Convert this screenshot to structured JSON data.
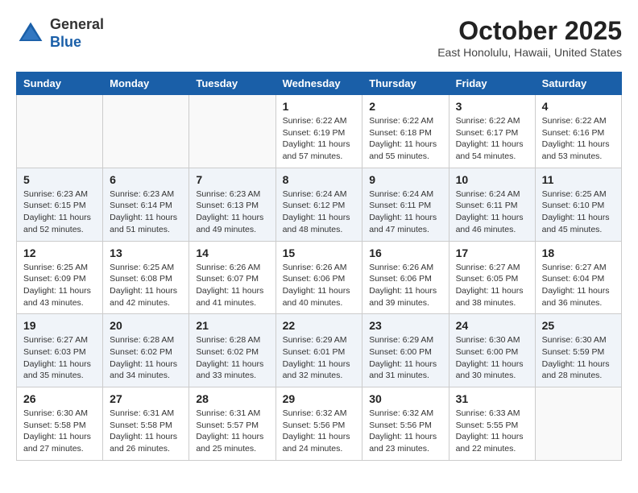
{
  "logo": {
    "general": "General",
    "blue": "Blue"
  },
  "header": {
    "month": "October 2025",
    "location": "East Honolulu, Hawaii, United States"
  },
  "days_of_week": [
    "Sunday",
    "Monday",
    "Tuesday",
    "Wednesday",
    "Thursday",
    "Friday",
    "Saturday"
  ],
  "weeks": [
    [
      {
        "day": "",
        "info": ""
      },
      {
        "day": "",
        "info": ""
      },
      {
        "day": "",
        "info": ""
      },
      {
        "day": "1",
        "info": "Sunrise: 6:22 AM\nSunset: 6:19 PM\nDaylight: 11 hours\nand 57 minutes."
      },
      {
        "day": "2",
        "info": "Sunrise: 6:22 AM\nSunset: 6:18 PM\nDaylight: 11 hours\nand 55 minutes."
      },
      {
        "day": "3",
        "info": "Sunrise: 6:22 AM\nSunset: 6:17 PM\nDaylight: 11 hours\nand 54 minutes."
      },
      {
        "day": "4",
        "info": "Sunrise: 6:22 AM\nSunset: 6:16 PM\nDaylight: 11 hours\nand 53 minutes."
      }
    ],
    [
      {
        "day": "5",
        "info": "Sunrise: 6:23 AM\nSunset: 6:15 PM\nDaylight: 11 hours\nand 52 minutes."
      },
      {
        "day": "6",
        "info": "Sunrise: 6:23 AM\nSunset: 6:14 PM\nDaylight: 11 hours\nand 51 minutes."
      },
      {
        "day": "7",
        "info": "Sunrise: 6:23 AM\nSunset: 6:13 PM\nDaylight: 11 hours\nand 49 minutes."
      },
      {
        "day": "8",
        "info": "Sunrise: 6:24 AM\nSunset: 6:12 PM\nDaylight: 11 hours\nand 48 minutes."
      },
      {
        "day": "9",
        "info": "Sunrise: 6:24 AM\nSunset: 6:11 PM\nDaylight: 11 hours\nand 47 minutes."
      },
      {
        "day": "10",
        "info": "Sunrise: 6:24 AM\nSunset: 6:11 PM\nDaylight: 11 hours\nand 46 minutes."
      },
      {
        "day": "11",
        "info": "Sunrise: 6:25 AM\nSunset: 6:10 PM\nDaylight: 11 hours\nand 45 minutes."
      }
    ],
    [
      {
        "day": "12",
        "info": "Sunrise: 6:25 AM\nSunset: 6:09 PM\nDaylight: 11 hours\nand 43 minutes."
      },
      {
        "day": "13",
        "info": "Sunrise: 6:25 AM\nSunset: 6:08 PM\nDaylight: 11 hours\nand 42 minutes."
      },
      {
        "day": "14",
        "info": "Sunrise: 6:26 AM\nSunset: 6:07 PM\nDaylight: 11 hours\nand 41 minutes."
      },
      {
        "day": "15",
        "info": "Sunrise: 6:26 AM\nSunset: 6:06 PM\nDaylight: 11 hours\nand 40 minutes."
      },
      {
        "day": "16",
        "info": "Sunrise: 6:26 AM\nSunset: 6:06 PM\nDaylight: 11 hours\nand 39 minutes."
      },
      {
        "day": "17",
        "info": "Sunrise: 6:27 AM\nSunset: 6:05 PM\nDaylight: 11 hours\nand 38 minutes."
      },
      {
        "day": "18",
        "info": "Sunrise: 6:27 AM\nSunset: 6:04 PM\nDaylight: 11 hours\nand 36 minutes."
      }
    ],
    [
      {
        "day": "19",
        "info": "Sunrise: 6:27 AM\nSunset: 6:03 PM\nDaylight: 11 hours\nand 35 minutes."
      },
      {
        "day": "20",
        "info": "Sunrise: 6:28 AM\nSunset: 6:02 PM\nDaylight: 11 hours\nand 34 minutes."
      },
      {
        "day": "21",
        "info": "Sunrise: 6:28 AM\nSunset: 6:02 PM\nDaylight: 11 hours\nand 33 minutes."
      },
      {
        "day": "22",
        "info": "Sunrise: 6:29 AM\nSunset: 6:01 PM\nDaylight: 11 hours\nand 32 minutes."
      },
      {
        "day": "23",
        "info": "Sunrise: 6:29 AM\nSunset: 6:00 PM\nDaylight: 11 hours\nand 31 minutes."
      },
      {
        "day": "24",
        "info": "Sunrise: 6:30 AM\nSunset: 6:00 PM\nDaylight: 11 hours\nand 30 minutes."
      },
      {
        "day": "25",
        "info": "Sunrise: 6:30 AM\nSunset: 5:59 PM\nDaylight: 11 hours\nand 28 minutes."
      }
    ],
    [
      {
        "day": "26",
        "info": "Sunrise: 6:30 AM\nSunset: 5:58 PM\nDaylight: 11 hours\nand 27 minutes."
      },
      {
        "day": "27",
        "info": "Sunrise: 6:31 AM\nSunset: 5:58 PM\nDaylight: 11 hours\nand 26 minutes."
      },
      {
        "day": "28",
        "info": "Sunrise: 6:31 AM\nSunset: 5:57 PM\nDaylight: 11 hours\nand 25 minutes."
      },
      {
        "day": "29",
        "info": "Sunrise: 6:32 AM\nSunset: 5:56 PM\nDaylight: 11 hours\nand 24 minutes."
      },
      {
        "day": "30",
        "info": "Sunrise: 6:32 AM\nSunset: 5:56 PM\nDaylight: 11 hours\nand 23 minutes."
      },
      {
        "day": "31",
        "info": "Sunrise: 6:33 AM\nSunset: 5:55 PM\nDaylight: 11 hours\nand 22 minutes."
      },
      {
        "day": "",
        "info": ""
      }
    ]
  ]
}
